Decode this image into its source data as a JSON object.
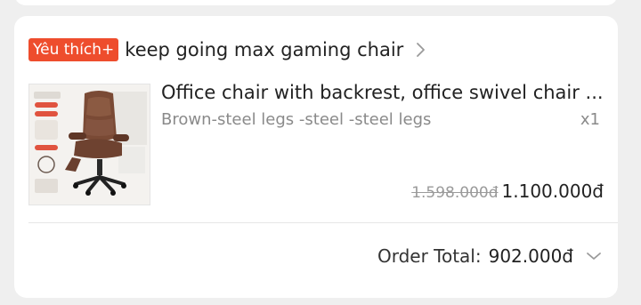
{
  "shop": {
    "badge": "Yêu thích+",
    "name": "keep going max gaming chair",
    "chevron_icon": "chevron-right-icon"
  },
  "product": {
    "image_icon": "office-chair-image",
    "name": "Office chair with backrest, office swivel chair ...",
    "variant": "Brown-steel legs -steel -steel legs",
    "quantity": "x1",
    "original_price": "1.598.000đ",
    "price": "1.100.000đ"
  },
  "order": {
    "total_label": "Order Total:",
    "total_value": "902.000đ",
    "expand_icon": "chevron-down-icon"
  },
  "colors": {
    "brand": "#ee4d2d",
    "background": "#efefef",
    "card": "#ffffff"
  }
}
